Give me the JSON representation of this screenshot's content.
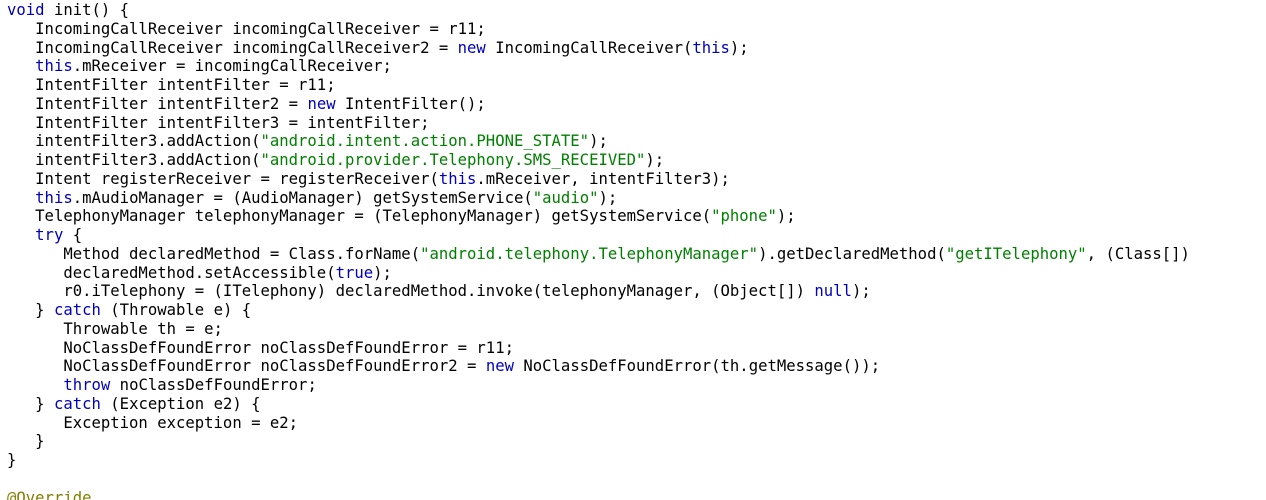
{
  "editor": {
    "colors": {
      "background": "#ffffff",
      "plain": "#000000",
      "keyword": "#0000c0",
      "string": "#008000",
      "annotation": "#808000"
    },
    "lines": [
      [
        {
          "t": "kw",
          "v": "void"
        },
        {
          "t": "plain",
          "v": " init() {"
        }
      ],
      [
        {
          "t": "plain",
          "v": "   IncomingCallReceiver incomingCallReceiver = r11;"
        }
      ],
      [
        {
          "t": "plain",
          "v": "   IncomingCallReceiver incomingCallReceiver2 = "
        },
        {
          "t": "kw",
          "v": "new"
        },
        {
          "t": "plain",
          "v": " IncomingCallReceiver("
        },
        {
          "t": "kw",
          "v": "this"
        },
        {
          "t": "plain",
          "v": ");"
        }
      ],
      [
        {
          "t": "plain",
          "v": "   "
        },
        {
          "t": "kw",
          "v": "this"
        },
        {
          "t": "plain",
          "v": ".mReceiver = incomingCallReceiver;"
        }
      ],
      [
        {
          "t": "plain",
          "v": "   IntentFilter intentFilter = r11;"
        }
      ],
      [
        {
          "t": "plain",
          "v": "   IntentFilter intentFilter2 = "
        },
        {
          "t": "kw",
          "v": "new"
        },
        {
          "t": "plain",
          "v": " IntentFilter();"
        }
      ],
      [
        {
          "t": "plain",
          "v": "   IntentFilter intentFilter3 = intentFilter;"
        }
      ],
      [
        {
          "t": "plain",
          "v": "   intentFilter3.addAction("
        },
        {
          "t": "str",
          "v": "\"android.intent.action.PHONE_STATE\""
        },
        {
          "t": "plain",
          "v": ");"
        }
      ],
      [
        {
          "t": "plain",
          "v": "   intentFilter3.addAction("
        },
        {
          "t": "str",
          "v": "\"android.provider.Telephony.SMS_RECEIVED\""
        },
        {
          "t": "plain",
          "v": ");"
        }
      ],
      [
        {
          "t": "plain",
          "v": "   Intent registerReceiver = registerReceiver("
        },
        {
          "t": "kw",
          "v": "this"
        },
        {
          "t": "plain",
          "v": ".mReceiver, intentFilter3);"
        }
      ],
      [
        {
          "t": "plain",
          "v": "   "
        },
        {
          "t": "kw",
          "v": "this"
        },
        {
          "t": "plain",
          "v": ".mAudioManager = (AudioManager) getSystemService("
        },
        {
          "t": "str",
          "v": "\"audio\""
        },
        {
          "t": "plain",
          "v": ");"
        }
      ],
      [
        {
          "t": "plain",
          "v": "   TelephonyManager telephonyManager = (TelephonyManager) getSystemService("
        },
        {
          "t": "str",
          "v": "\"phone\""
        },
        {
          "t": "plain",
          "v": ");"
        }
      ],
      [
        {
          "t": "plain",
          "v": "   "
        },
        {
          "t": "kw",
          "v": "try"
        },
        {
          "t": "plain",
          "v": " {"
        }
      ],
      [
        {
          "t": "plain",
          "v": "      Method declaredMethod = Class.forName("
        },
        {
          "t": "str",
          "v": "\"android.telephony.TelephonyManager\""
        },
        {
          "t": "plain",
          "v": ").getDeclaredMethod("
        },
        {
          "t": "str",
          "v": "\"getITelephony\""
        },
        {
          "t": "plain",
          "v": ", (Class[])"
        }
      ],
      [
        {
          "t": "plain",
          "v": "      declaredMethod.setAccessible("
        },
        {
          "t": "kw",
          "v": "true"
        },
        {
          "t": "plain",
          "v": ");"
        }
      ],
      [
        {
          "t": "plain",
          "v": "      r0.iTelephony = (ITelephony) declaredMethod.invoke(telephonyManager, (Object[]) "
        },
        {
          "t": "kw",
          "v": "null"
        },
        {
          "t": "plain",
          "v": ");"
        }
      ],
      [
        {
          "t": "plain",
          "v": "   } "
        },
        {
          "t": "kw",
          "v": "catch"
        },
        {
          "t": "plain",
          "v": " (Throwable e) {"
        }
      ],
      [
        {
          "t": "plain",
          "v": "      Throwable th = e;"
        }
      ],
      [
        {
          "t": "plain",
          "v": "      NoClassDefFoundError noClassDefFoundError = r11;"
        }
      ],
      [
        {
          "t": "plain",
          "v": "      NoClassDefFoundError noClassDefFoundError2 = "
        },
        {
          "t": "kw",
          "v": "new"
        },
        {
          "t": "plain",
          "v": " NoClassDefFoundError(th.getMessage());"
        }
      ],
      [
        {
          "t": "plain",
          "v": "      "
        },
        {
          "t": "kw",
          "v": "throw"
        },
        {
          "t": "plain",
          "v": " noClassDefFoundError;"
        }
      ],
      [
        {
          "t": "plain",
          "v": "   } "
        },
        {
          "t": "kw",
          "v": "catch"
        },
        {
          "t": "plain",
          "v": " (Exception e2) {"
        }
      ],
      [
        {
          "t": "plain",
          "v": "      Exception exception = e2;"
        }
      ],
      [
        {
          "t": "plain",
          "v": "   }"
        }
      ],
      [
        {
          "t": "plain",
          "v": "}"
        }
      ],
      [
        {
          "t": "plain",
          "v": ""
        }
      ],
      [
        {
          "t": "ann",
          "v": "@Override"
        }
      ]
    ]
  }
}
